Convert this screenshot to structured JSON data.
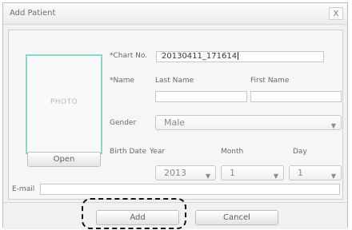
{
  "window": {
    "title": "Add Patient",
    "close_label": "X"
  },
  "photo": {
    "label": "PHOTO",
    "open_button": "Open"
  },
  "form": {
    "chart_no": {
      "label": "*Chart No.",
      "value": "20130411_171614"
    },
    "name": {
      "label": "*Name",
      "last_name_label": "Last Name",
      "first_name_label": "First Name",
      "last_name_value": "",
      "first_name_value": ""
    },
    "gender": {
      "label": "Gender",
      "selected": "Male"
    },
    "birth_date": {
      "label": "Birth Date",
      "year_label": "Year",
      "month_label": "Month",
      "day_label": "Day",
      "year": "2013",
      "month": "1",
      "day": "1"
    },
    "email": {
      "label": "E-mail",
      "value": ""
    }
  },
  "actions": {
    "add": "Add",
    "cancel": "Cancel"
  },
  "colors": {
    "photo_border": "#8fd4c8",
    "focus_ring": "#111111"
  }
}
